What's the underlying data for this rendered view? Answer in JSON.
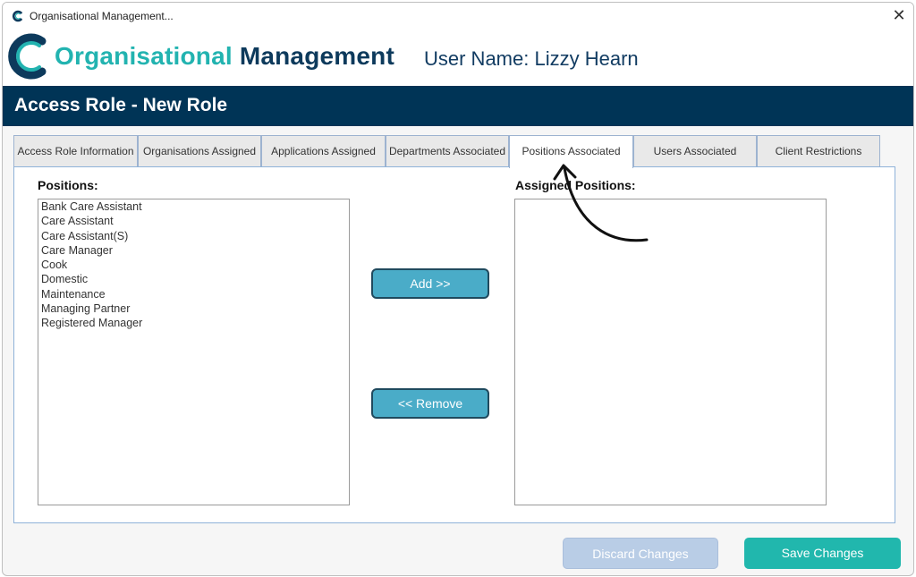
{
  "window": {
    "title": "Organisational Management..."
  },
  "header": {
    "brand_part1": "Organisational",
    "brand_part2": "Management",
    "user_label": "User Name: Lizzy Hearn"
  },
  "banner": {
    "title": "Access Role - New Role"
  },
  "tabs": [
    {
      "label": "Access Role Information",
      "active": false
    },
    {
      "label": "Organisations Assigned",
      "active": false
    },
    {
      "label": "Applications Assigned",
      "active": false
    },
    {
      "label": "Departments Associated",
      "active": false
    },
    {
      "label": "Positions Associated",
      "active": true
    },
    {
      "label": "Users Associated",
      "active": false
    },
    {
      "label": "Client Restrictions",
      "active": false
    }
  ],
  "positions": {
    "label": "Positions:",
    "items": [
      "Bank Care Assistant",
      "Care Assistant",
      "Care Assistant(S)",
      "Care Manager",
      "Cook",
      "Domestic",
      "Maintenance",
      "Managing Partner",
      "Registered Manager"
    ]
  },
  "assigned": {
    "label": "Assigned Positions:",
    "items": []
  },
  "actions": {
    "add_label": "Add  >>",
    "remove_label": "<< Remove"
  },
  "footer": {
    "discard_label": "Discard Changes",
    "save_label": "Save Changes"
  },
  "colors": {
    "banner": "#003456",
    "brand_teal": "#22b3b0",
    "brand_navy": "#0d3a5c",
    "save": "#21b7ad",
    "discard": "#b9cde6",
    "mid_button": "#4aacc8"
  }
}
